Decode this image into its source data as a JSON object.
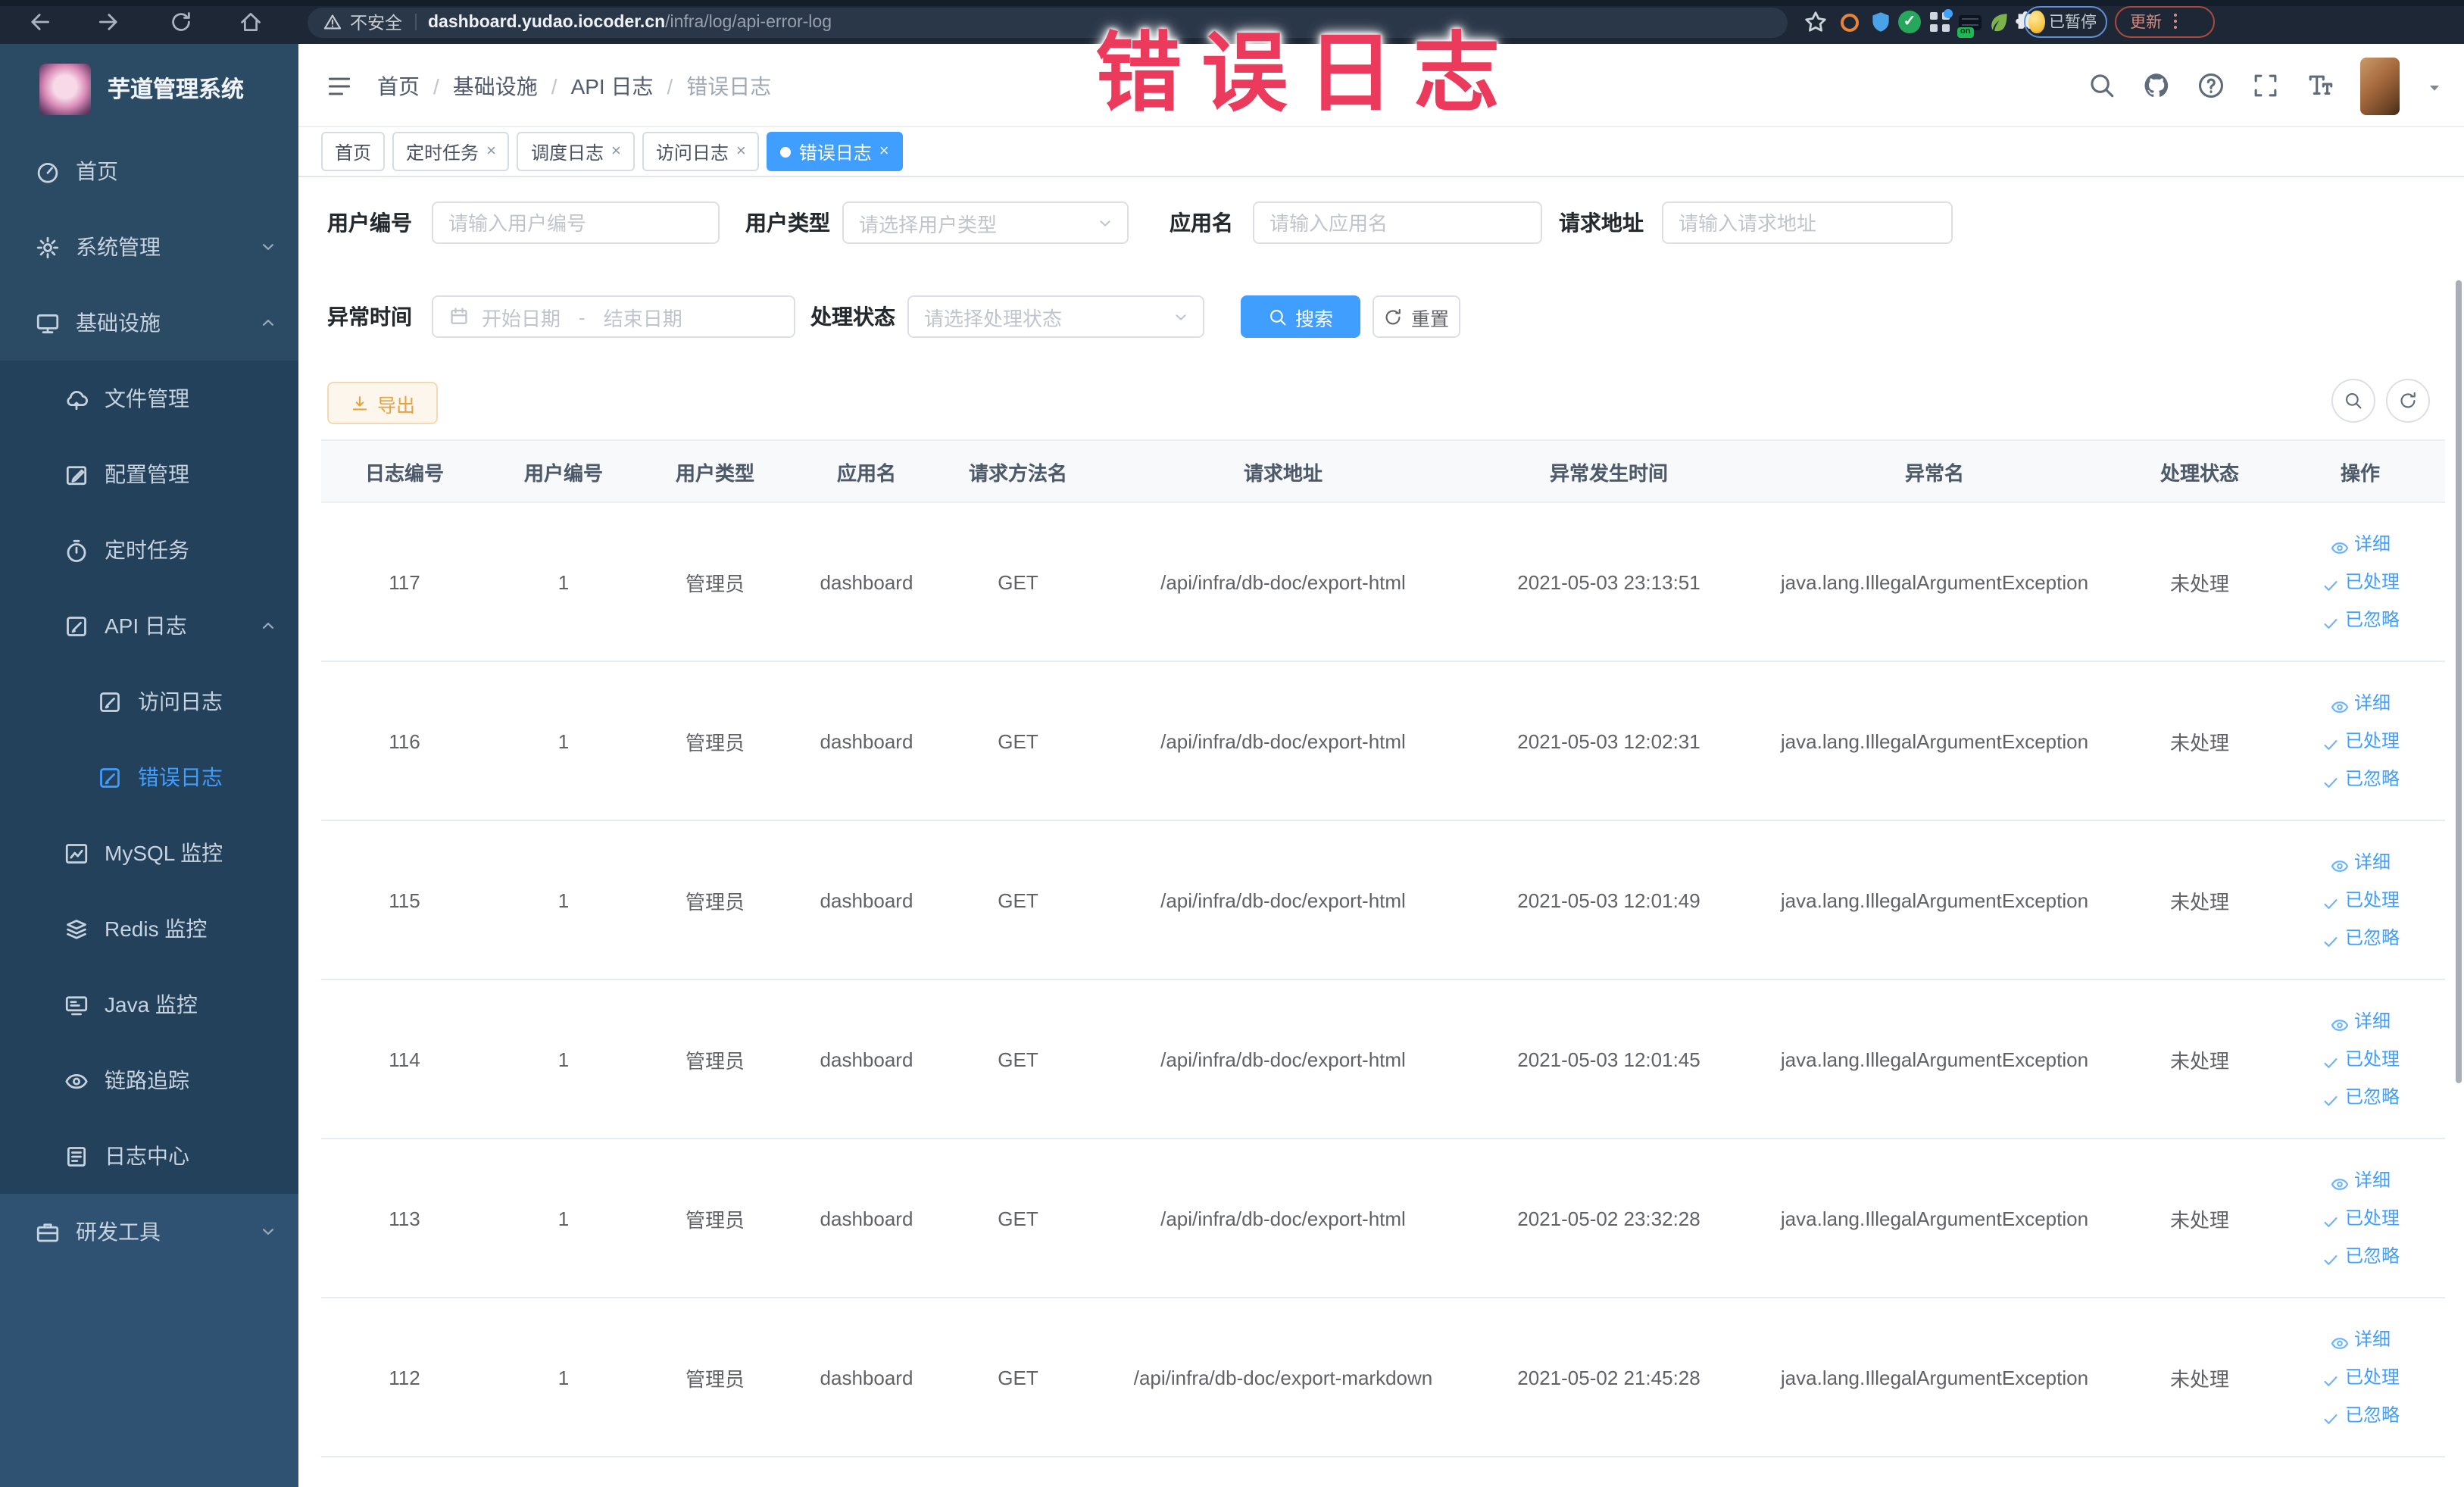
{
  "browser": {
    "security_label": "不安全",
    "url_domain": "dashboard.yudao.iocoder.cn",
    "url_path": "/infra/log/api-error-log",
    "profile_badge": "已暂停",
    "update_label": "更新",
    "toggle_on_label": "on"
  },
  "overlay_title": "错误日志",
  "colors": {
    "accent": "#409eff",
    "warning_button": "#e6a23c",
    "overlay_pink": "#ec3a5c",
    "sidebar_bg": "#2b4a64",
    "chrome_bg": "#1d2736"
  },
  "sidebar": {
    "app_title": "芋道管理系统",
    "items": [
      {
        "label": "首页",
        "icon": "dashboard",
        "level": 1,
        "section": "top"
      },
      {
        "label": "系统管理",
        "icon": "gear",
        "level": 1,
        "chevron": "down",
        "section": "top"
      },
      {
        "label": "基础设施",
        "icon": "monitor",
        "level": 1,
        "chevron": "up",
        "section": "top"
      },
      {
        "label": "文件管理",
        "icon": "cloud",
        "level": 2,
        "section": "sub"
      },
      {
        "label": "配置管理",
        "icon": "edit",
        "level": 2,
        "section": "sub"
      },
      {
        "label": "定时任务",
        "icon": "timer",
        "level": 2,
        "section": "sub"
      },
      {
        "label": "API 日志",
        "icon": "doc",
        "level": 2,
        "chevron": "up",
        "section": "sub"
      },
      {
        "label": "访问日志",
        "icon": "doc",
        "level": 3,
        "section": "sub"
      },
      {
        "label": "错误日志",
        "icon": "doc",
        "level": 3,
        "active": true,
        "section": "sub"
      },
      {
        "label": "MySQL 监控",
        "icon": "chart",
        "level": 2,
        "section": "sub"
      },
      {
        "label": "Redis 监控",
        "icon": "layers",
        "level": 2,
        "section": "sub"
      },
      {
        "label": "Java 监控",
        "icon": "java",
        "level": 2,
        "section": "sub"
      },
      {
        "label": "链路追踪",
        "icon": "eye",
        "level": 2,
        "section": "sub"
      },
      {
        "label": "日志中心",
        "icon": "log",
        "level": 2,
        "section": "sub"
      },
      {
        "label": "研发工具",
        "icon": "toolbox",
        "level": 1,
        "chevron": "down",
        "section": "bottom"
      }
    ]
  },
  "header": {
    "breadcrumb": [
      "首页",
      "基础设施",
      "API 日志",
      "错误日志"
    ],
    "separator": "/"
  },
  "tabs": [
    {
      "label": "首页",
      "closable": false,
      "active": false
    },
    {
      "label": "定时任务",
      "closable": true,
      "active": false
    },
    {
      "label": "调度日志",
      "closable": true,
      "active": false
    },
    {
      "label": "访问日志",
      "closable": true,
      "active": false
    },
    {
      "label": "错误日志",
      "closable": true,
      "active": true
    }
  ],
  "filters": {
    "user_id": {
      "label": "用户编号",
      "placeholder": "请输入用户编号"
    },
    "user_type": {
      "label": "用户类型",
      "placeholder": "请选择用户类型"
    },
    "app_name": {
      "label": "应用名",
      "placeholder": "请输入应用名"
    },
    "request_url": {
      "label": "请求地址",
      "placeholder": "请输入请求地址"
    },
    "exception_time": {
      "label": "异常时间",
      "start_placeholder": "开始日期",
      "separator": "-",
      "end_placeholder": "结束日期"
    },
    "process_status": {
      "label": "处理状态",
      "placeholder": "请选择处理状态"
    },
    "search_label": "搜索",
    "reset_label": "重置"
  },
  "toolbar": {
    "export_label": "导出"
  },
  "table": {
    "columns": [
      "日志编号",
      "用户编号",
      "用户类型",
      "应用名",
      "请求方法名",
      "请求地址",
      "异常发生时间",
      "异常名",
      "处理状态",
      "操作"
    ],
    "actions": [
      "详细",
      "已处理",
      "已忽略"
    ],
    "rows": [
      {
        "id": "117",
        "user_id": "1",
        "user_type": "管理员",
        "app": "dashboard",
        "method": "GET",
        "url": "/api/infra/db-doc/export-html",
        "time": "2021-05-03 23:13:51",
        "exception": "java.lang.IllegalArgumentException",
        "status": "未处理"
      },
      {
        "id": "116",
        "user_id": "1",
        "user_type": "管理员",
        "app": "dashboard",
        "method": "GET",
        "url": "/api/infra/db-doc/export-html",
        "time": "2021-05-03 12:02:31",
        "exception": "java.lang.IllegalArgumentException",
        "status": "未处理"
      },
      {
        "id": "115",
        "user_id": "1",
        "user_type": "管理员",
        "app": "dashboard",
        "method": "GET",
        "url": "/api/infra/db-doc/export-html",
        "time": "2021-05-03 12:01:49",
        "exception": "java.lang.IllegalArgumentException",
        "status": "未处理"
      },
      {
        "id": "114",
        "user_id": "1",
        "user_type": "管理员",
        "app": "dashboard",
        "method": "GET",
        "url": "/api/infra/db-doc/export-html",
        "time": "2021-05-03 12:01:45",
        "exception": "java.lang.IllegalArgumentException",
        "status": "未处理"
      },
      {
        "id": "113",
        "user_id": "1",
        "user_type": "管理员",
        "app": "dashboard",
        "method": "GET",
        "url": "/api/infra/db-doc/export-html",
        "time": "2021-05-02 23:32:28",
        "exception": "java.lang.IllegalArgumentException",
        "status": "未处理"
      },
      {
        "id": "112",
        "user_id": "1",
        "user_type": "管理员",
        "app": "dashboard",
        "method": "GET",
        "url": "/api/infra/db-doc/export-markdown",
        "time": "2021-05-02 21:45:28",
        "exception": "java.lang.IllegalArgumentException",
        "status": "未处理"
      }
    ]
  }
}
